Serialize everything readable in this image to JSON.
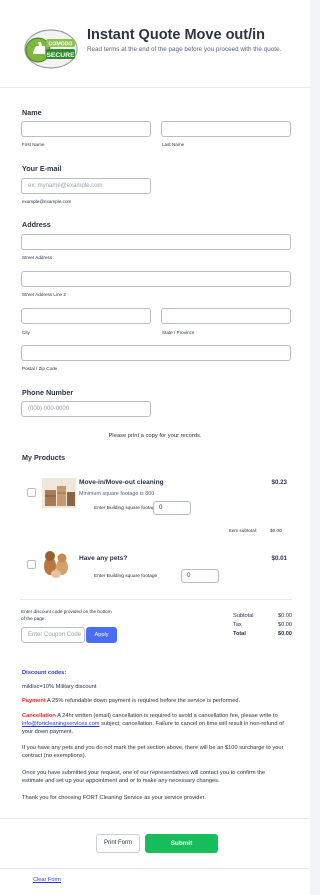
{
  "header": {
    "badge_line1": "COMODO",
    "badge_line2": "SECURE",
    "title": "Instant Quote Move out/in",
    "subtitle": "Read terms at the end of the page before you proceed with the quote."
  },
  "name": {
    "label": "Name",
    "first_sublabel": "First Name",
    "last_sublabel": "Last Name",
    "first_value": "",
    "last_value": ""
  },
  "email": {
    "label": "Your E-mail",
    "placeholder": "ex: myname@example.com",
    "sublabel": "example@example.com"
  },
  "address": {
    "label": "Address",
    "street_sublabel": "Street Address",
    "street2_sublabel": "Street Address Line 2",
    "city_sublabel": "City",
    "state_sublabel": "State / Province",
    "postal_sublabel": "Postal / Zip Code"
  },
  "phone": {
    "label": "Phone Number",
    "placeholder": "(000) 000-0000"
  },
  "print_note": "Please print a copy for your records.",
  "products": {
    "label": "My Products",
    "items": [
      {
        "name": "Move-in/Move-out cleaning",
        "price": "$0.23",
        "description": "Minimum square footage is 800",
        "qty_label": "Enter Building square footage",
        "qty_value": "0"
      },
      {
        "name": "Have any pets?",
        "price": "$0.01",
        "qty_label": "Enter Building square footage",
        "qty_value": "0"
      }
    ],
    "item_subtotal_label": "Item subtotal:",
    "item_subtotal_value": "$0.00"
  },
  "coupon": {
    "label": "Enter discount code provided on the bottom of the page.",
    "placeholder": "Enter Coupon Code",
    "apply_label": "Apply"
  },
  "totals": {
    "subtotal_label": "Subtotal",
    "subtotal_value": "$0.00",
    "tax_label": "Tax",
    "tax_value": "$0.00",
    "total_label": "Total",
    "total_value": "$0.00"
  },
  "info": {
    "discount_heading": "Discount codes:",
    "discount_line": "mildisc=10% Military discount",
    "payment_label": "Payment",
    "payment_text": " A 25% refundable down payment is required before the service is performed.",
    "cancellation_label": "Cancellation",
    "cancellation_text_1": " A 24hr written (email) cancellation is required to avoid a cancellation fee, please write to ",
    "cancellation_email": "info@fortcleaningservices.com",
    "cancellation_text_2": " subject; cancellation. Failure to cancel on time will result in non-refund of your down payment.",
    "pets_text": "If you have any pets and you do not mark the pet section above, there will be an $100 surcharge to your contract (no exemptions).",
    "contact_text": "Once you have submitted your request, one of our representatives will contact you to confirm the estimate and set up your appointment and or to make any necessary changes.",
    "thanks_text": "Thank you for choosing FORT Cleaning Service as your service provider."
  },
  "actions": {
    "print_label": "Print Form",
    "submit_label": "Submit",
    "clear_label": "Clear Form"
  },
  "colors": {
    "accent": "#4a6cf7",
    "submit": "#18bd5b",
    "link": "#2b3ad6",
    "warning": "#e32b2b"
  }
}
